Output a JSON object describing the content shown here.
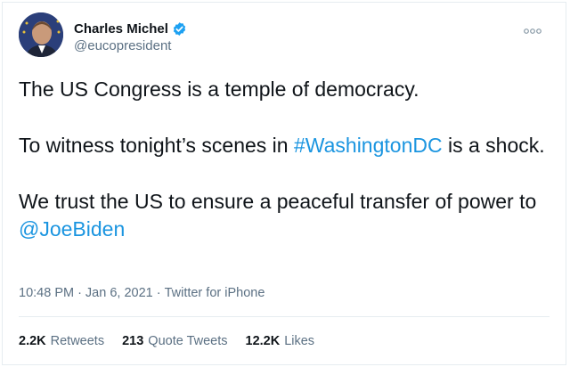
{
  "author": {
    "display_name": "Charles Michel",
    "handle": "@eucopresident",
    "avatar_icon": "profile-photo",
    "verified_icon": "verified-badge-icon"
  },
  "tweet": {
    "paragraph_1": "The US Congress is a temple of democracy.",
    "paragraph_2": {
      "before": "To witness tonight’s scenes in ",
      "hashtag": "#WashingtonDC",
      "after": " is a shock."
    },
    "paragraph_3": {
      "before": "We trust the US to ensure a peaceful transfer of power to ",
      "mention": "@JoeBiden"
    }
  },
  "meta": {
    "time": "10:48 PM",
    "separator_1": "·",
    "date": "Jan 6, 2021",
    "separator_2": "·",
    "source": "Twitter for iPhone"
  },
  "stats": {
    "retweets_count": "2.2K",
    "retweets_label": "Retweets",
    "quotes_count": "213",
    "quotes_label": "Quote Tweets",
    "likes_count": "12.2K",
    "likes_label": "Likes"
  },
  "colors": {
    "link": "#1b95e0",
    "secondary_text": "#5b7083",
    "verified": "#1da1f2"
  }
}
